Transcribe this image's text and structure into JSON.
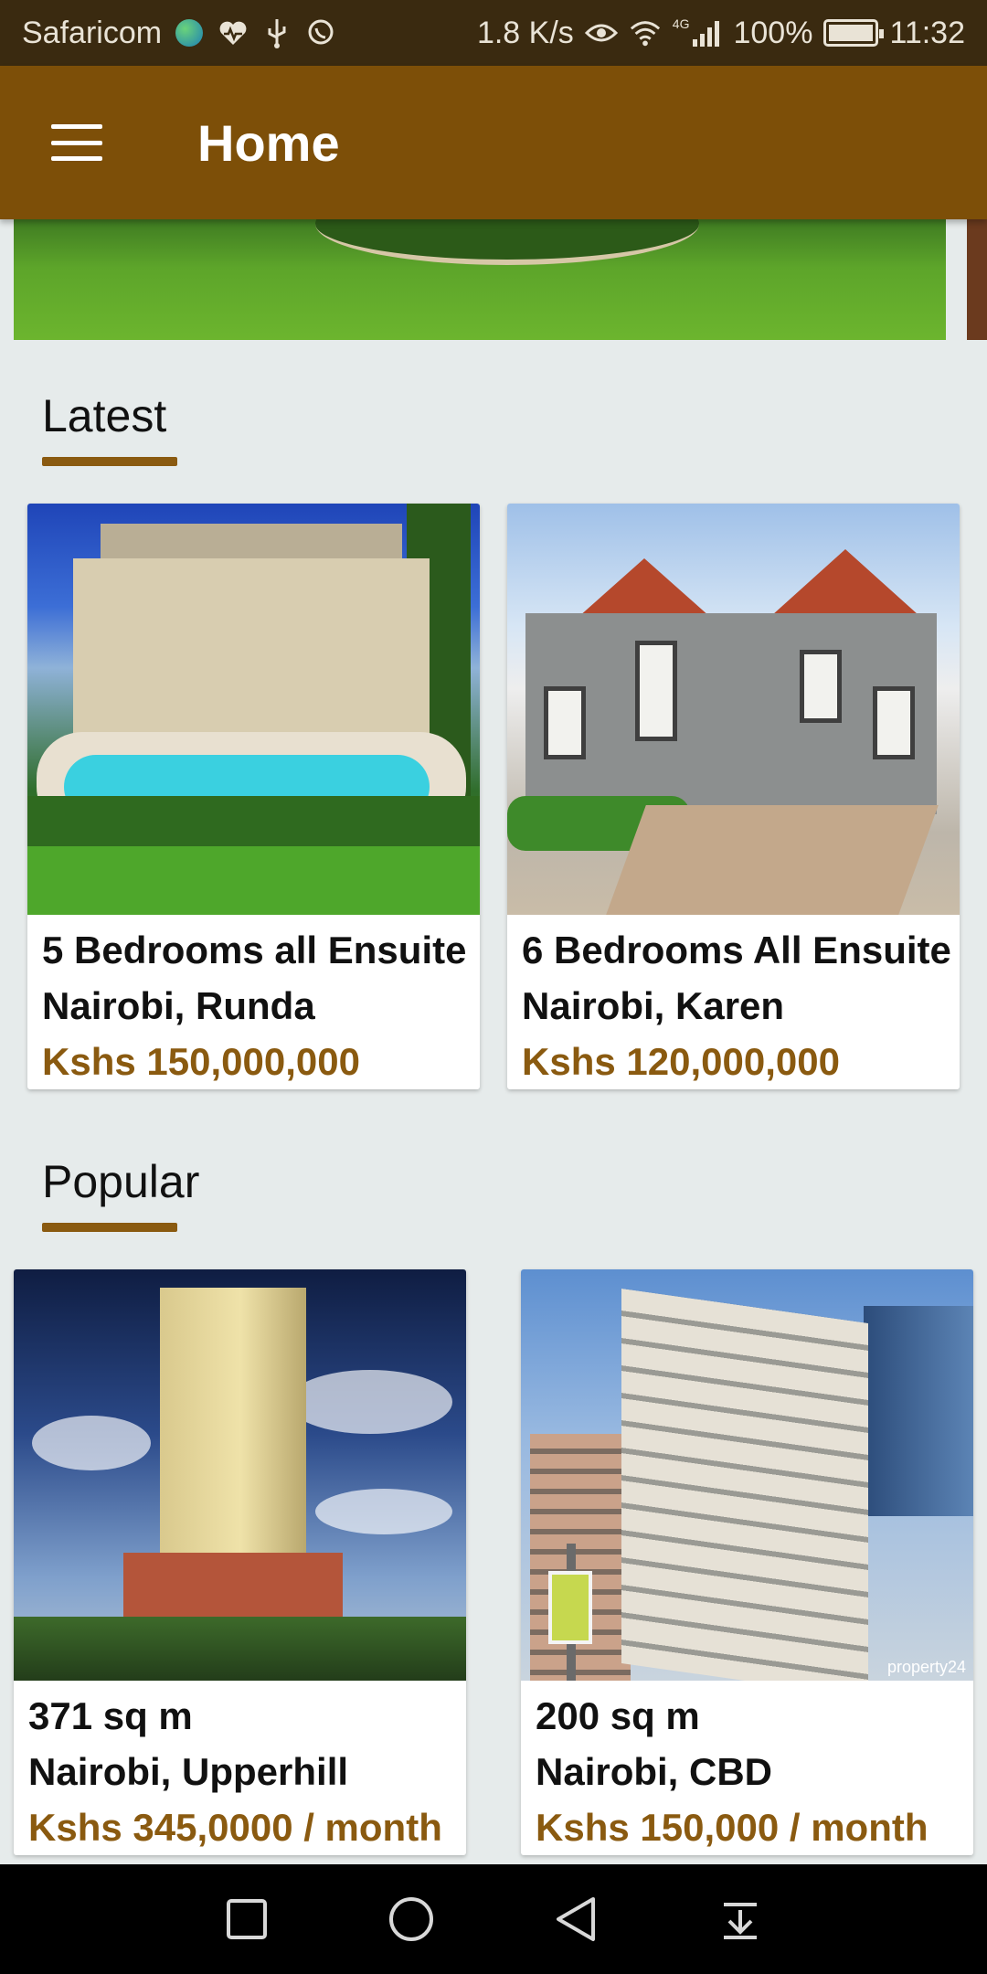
{
  "status_bar": {
    "carrier": "Safaricom",
    "net_speed": "1.8 K/s",
    "network_type": "4G",
    "battery": "100%",
    "time": "11:32"
  },
  "app_bar": {
    "title": "Home",
    "menu_icon": "hamburger-menu-icon"
  },
  "sections": {
    "latest": {
      "title": "Latest",
      "cards": [
        {
          "line1": "5 Bedrooms all Ensuite",
          "line2": "Nairobi, Runda",
          "price": "Kshs 150,000,000"
        },
        {
          "line1": "6 Bedrooms All Ensuite",
          "line2": "Nairobi, Karen",
          "price": "Kshs 120,000,000"
        }
      ]
    },
    "popular": {
      "title": "Popular",
      "cards": [
        {
          "line1": "371 sq m",
          "line2": "Nairobi, Upperhill",
          "price": "Kshs 345,0000 / month"
        },
        {
          "line1": "200 sq m",
          "line2": "Nairobi, CBD",
          "price": "Kshs 150,000 / month",
          "watermark": "property24"
        }
      ]
    }
  },
  "colors": {
    "app_bar": "#7d4f08",
    "accent": "#8a5a10",
    "status_bar": "#3a2a10",
    "background": "#e6ebeb"
  }
}
